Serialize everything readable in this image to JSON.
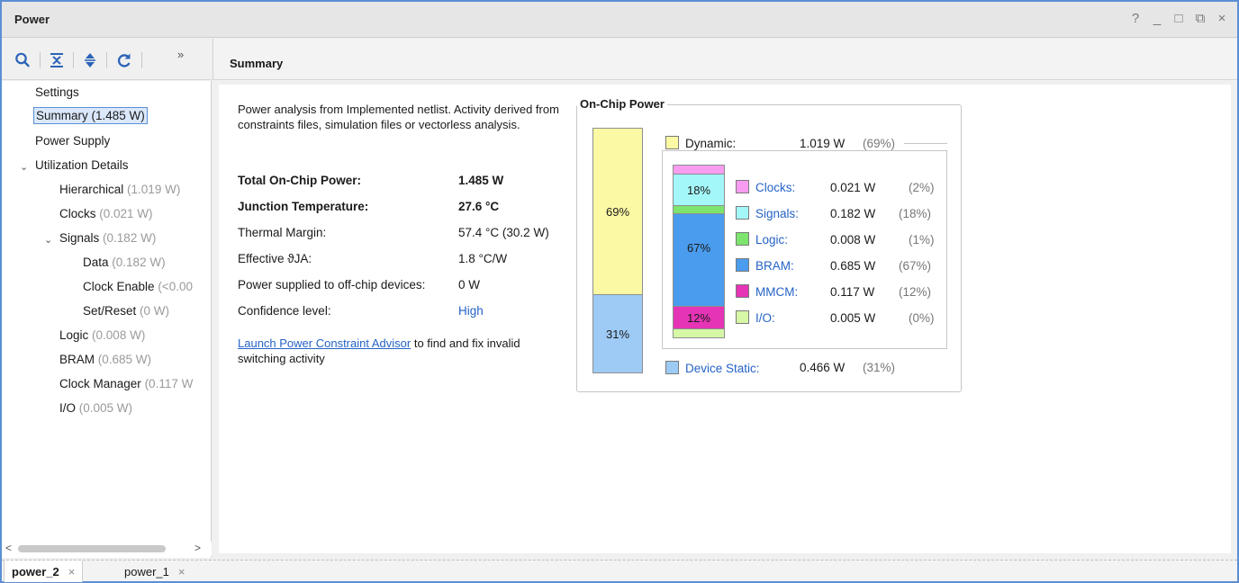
{
  "window": {
    "title": "Power",
    "controls": [
      "?",
      "_",
      "□",
      "⧉",
      "×"
    ]
  },
  "toolbar": {
    "more": "»"
  },
  "right_header": {
    "title": "Summary"
  },
  "tree": {
    "settings": "Settings",
    "summary": "Summary (1.485 W)",
    "power_supply": "Power Supply",
    "utilization": "Utilization Details",
    "hierarchical": {
      "label": "Hierarchical",
      "value": "(1.019 W)"
    },
    "clocks": {
      "label": "Clocks",
      "value": "(0.021 W)"
    },
    "signals": {
      "label": "Signals",
      "value": "(0.182 W)"
    },
    "data": {
      "label": "Data",
      "value": "(0.182 W)"
    },
    "clock_enable": {
      "label": "Clock Enable",
      "value": "(<0.00"
    },
    "set_reset": {
      "label": "Set/Reset",
      "value": "(0 W)"
    },
    "logic": {
      "label": "Logic",
      "value": "(0.008 W)"
    },
    "bram": {
      "label": "BRAM",
      "value": "(0.685 W)"
    },
    "clock_manager": {
      "label": "Clock Manager",
      "value": "(0.117 W"
    },
    "io": {
      "label": "I/O",
      "value": "(0.005 W)"
    }
  },
  "summary": {
    "intro": "Power analysis from Implemented netlist. Activity derived from constraints files, simulation files or vectorless analysis.",
    "rows": [
      {
        "label": "Total On-Chip Power:",
        "value": "1.485 W"
      },
      {
        "label": "Junction Temperature:",
        "value": "27.6 °C"
      },
      {
        "label": "Thermal Margin:",
        "value": "57.4 °C (30.2 W)"
      },
      {
        "label": "Effective ϑJA:",
        "value": "1.8 °C/W"
      },
      {
        "label": "Power supplied to off-chip devices:",
        "value": "0 W"
      },
      {
        "label": "Confidence level:",
        "value": "High"
      }
    ],
    "launch_link": "Launch Power Constraint Advisor",
    "launch_rest": " to find and fix invalid switching activity"
  },
  "on_chip": {
    "title": "On-Chip Power",
    "dynamic": {
      "label": "Dynamic:",
      "value": "1.019 W",
      "pct": "(69%)",
      "bar_label": "69%",
      "color": "#fbf9a4"
    },
    "static": {
      "label": "Device Static:",
      "value": "0.466 W",
      "pct": "(31%)",
      "bar_label": "31%",
      "color": "#9ecbf6"
    },
    "components": [
      {
        "label": "Clocks:",
        "value": "0.021 W",
        "pct": "(2%)",
        "color": "#f79cf0"
      },
      {
        "label": "Signals:",
        "value": "0.182 W",
        "pct": "(18%)",
        "color": "#a4f7f9",
        "bar_label": "18%"
      },
      {
        "label": "Logic:",
        "value": "0.008 W",
        "pct": "(1%)",
        "color": "#7de46e"
      },
      {
        "label": "BRAM:",
        "value": "0.685 W",
        "pct": "(67%)",
        "color": "#4a9cee",
        "bar_label": "67%"
      },
      {
        "label": "MMCM:",
        "value": "0.117 W",
        "pct": "(12%)",
        "color": "#e534b5",
        "bar_label": "12%"
      },
      {
        "label": "I/O:",
        "value": "0.005 W",
        "pct": "(0%)",
        "color": "#d6f7a6"
      }
    ]
  },
  "tabs": [
    {
      "label": "power_2",
      "close": "×",
      "active": true
    },
    {
      "label": "power_1",
      "close": "×",
      "active": false
    }
  ]
}
